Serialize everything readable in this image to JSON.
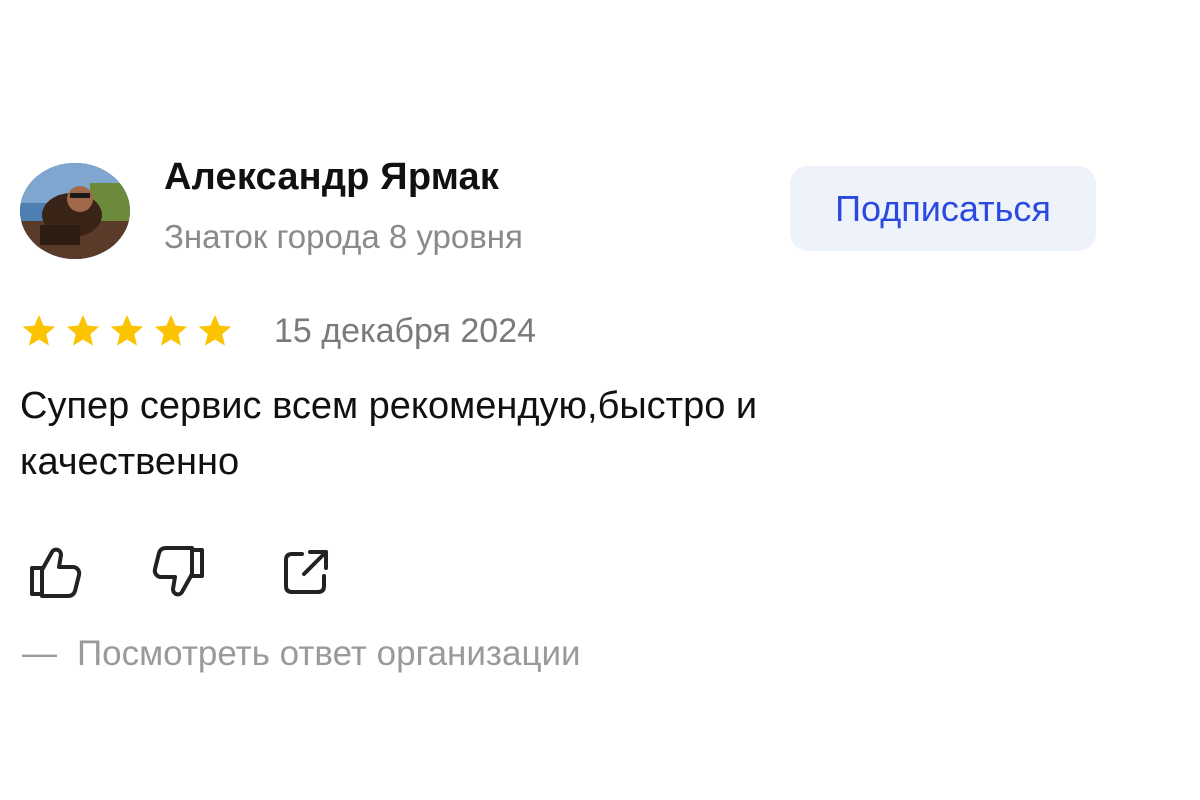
{
  "author": {
    "name": "Александр Ярмак",
    "level": "Знаток города 8 уровня"
  },
  "subscribe_label": "Подписаться",
  "rating": {
    "stars": 5,
    "max": 5,
    "date": "15 декабря 2024"
  },
  "review_text": "Супер сервис всем рекомендую,быстро и качественно",
  "actions": {
    "like_icon": "thumbs-up-icon",
    "dislike_icon": "thumbs-down-icon",
    "share_icon": "share-icon"
  },
  "org_reply": {
    "dash": "—",
    "label": "Посмотреть ответ организации"
  },
  "colors": {
    "accent": "#2949e0",
    "star": "#fcc400",
    "button_bg": "#eef2fb",
    "muted_text": "#8a8a8a"
  }
}
